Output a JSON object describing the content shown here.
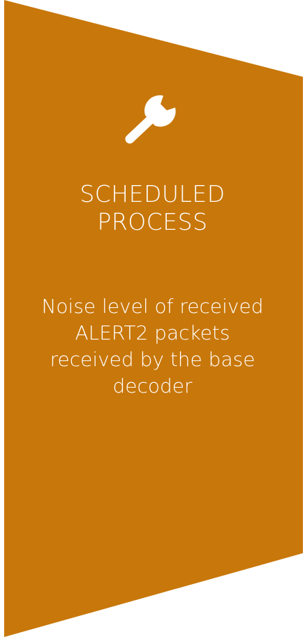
{
  "panel": {
    "fill_color": "#C8770A",
    "text_color": "#FFFFFF",
    "icon": "wrench-icon",
    "title_lines": [
      "SCHEDULED",
      "PROCESS"
    ],
    "description_lines": [
      "Noise level of received",
      "ALERT2 packets",
      "received by the base",
      "decoder"
    ]
  }
}
